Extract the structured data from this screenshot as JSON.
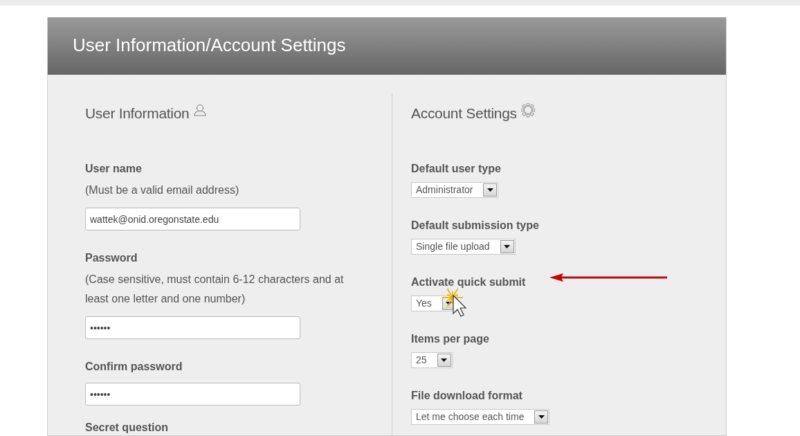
{
  "header": {
    "title": "User Information/Account Settings"
  },
  "user_information": {
    "heading": "User Information",
    "fields": [
      {
        "kind": "input",
        "label": "User name",
        "hint": "(Must be a valid email address)",
        "value": "wattek@onid.oregonstate.edu"
      },
      {
        "kind": "input",
        "label": "Password",
        "hint": "(Case sensitive, must contain 6-12 characters and at least one letter and one number)",
        "value": "••••••"
      },
      {
        "kind": "input",
        "label": "Confirm password",
        "value": "••••••"
      },
      {
        "kind": "cut",
        "label": "Secret question"
      }
    ]
  },
  "account_settings": {
    "heading": "Account Settings",
    "fields": [
      {
        "label": "Default user type",
        "value": "Administrator",
        "highlighted": false
      },
      {
        "label": "Default submission type",
        "value": "Single file upload",
        "highlighted": false
      },
      {
        "label": "Activate quick submit",
        "value": "Yes",
        "highlighted": true
      },
      {
        "label": "Items per page",
        "value": "25",
        "highlighted": false
      },
      {
        "label": "File download format",
        "value": "Let me choose each time",
        "highlighted": false
      }
    ]
  }
}
